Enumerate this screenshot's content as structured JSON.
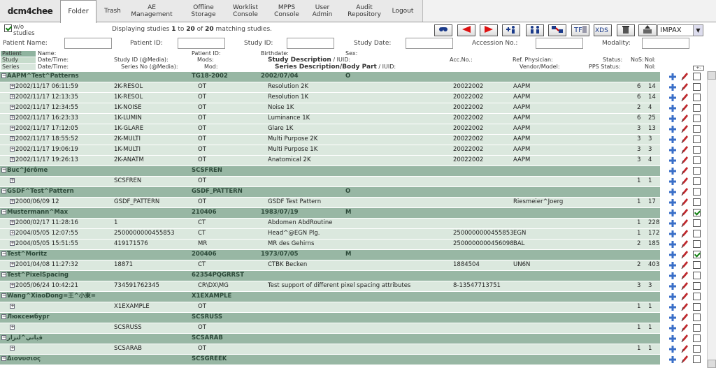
{
  "app": {
    "logo": "dcm4chee"
  },
  "tabs": [
    {
      "label": "Folder",
      "active": true
    },
    {
      "label": "Trash"
    },
    {
      "label": "AE\nManagement"
    },
    {
      "label": "Offline\nStorage"
    },
    {
      "label": "Worklist\nConsole"
    },
    {
      "label": "MPPS\nConsole"
    },
    {
      "label": "User\nAdmin"
    },
    {
      "label": "Audit\nRepository"
    },
    {
      "label": "Logout"
    }
  ],
  "toolbar": {
    "wo_label": "w/o studies",
    "wo_checked": true,
    "display_prefix": "Displaying studies ",
    "from": "1",
    "to_word": " to ",
    "to": "20",
    "of_word": " of ",
    "total": "20",
    "suffix": " matching studies.",
    "buttons": [
      "search-icon",
      "prev-icon",
      "next-icon",
      "add-patient-icon",
      "merge-patients-icon",
      "move-studies-icon",
      "tf-export-icon",
      "xds-export-icon",
      "trash-icon",
      "send-icon"
    ],
    "aet_select": "IMPAX"
  },
  "filters": {
    "patient_name": {
      "label": "Patient Name:",
      "value": ""
    },
    "patient_id": {
      "label": "Patient ID:",
      "value": ""
    },
    "study_id": {
      "label": "Study ID:",
      "value": ""
    },
    "study_date": {
      "label": "Study Date:",
      "value": ""
    },
    "accession": {
      "label": "Accession No.:",
      "value": ""
    },
    "modality": {
      "label": "Modality:",
      "value": ""
    }
  },
  "header": {
    "l_patient": "Patient",
    "l_study": "Study",
    "l_series": "Series",
    "name": "Name:",
    "patient_id": "Patient ID:",
    "birthdate": "Birthdate:",
    "sex": "Sex:",
    "study_datetime": "Date/Time:",
    "study_id": "Study ID (@Media):",
    "mods": "Mods:",
    "study_desc": "Study Description",
    "iuid1": " / IUID:",
    "acc": "Acc.No.:",
    "ref_phys": "Ref. Physician:",
    "status": "Status:",
    "nos": "NoS:",
    "noi": "NoI:",
    "series_datetime": "Date/Time:",
    "series_no": "Series No (@Media):",
    "mod": "Mod:",
    "series_desc": "Series Description/Body Part",
    "iuid2": " / IUID:",
    "vendor": "Vendor/Model:",
    "pps_status": "PPS Status:",
    "noi2": "NoI:"
  },
  "rows": [
    {
      "type": "pat",
      "name": "AAPM^Test^Patterns",
      "pid": "TG18-2002",
      "birth": "2002/07/04",
      "sex": "O"
    },
    {
      "type": "ser",
      "dt": "2002/11/17 06:11:59",
      "no": "2K-RESOL",
      "mod": "OT",
      "desc": "Resolution 2K",
      "acc": "20022002",
      "ref": "AAPM",
      "nos": "6",
      "noi": "14"
    },
    {
      "type": "ser",
      "dt": "2002/11/17 12:13:35",
      "no": "1K-RESOL",
      "mod": "OT",
      "desc": "Resolution 1K",
      "acc": "20022002",
      "ref": "AAPM",
      "nos": "6",
      "noi": "14"
    },
    {
      "type": "ser",
      "dt": "2002/11/17 12:34:55",
      "no": "1K-NOISE",
      "mod": "OT",
      "desc": "Noise 1K",
      "acc": "20022002",
      "ref": "AAPM",
      "nos": "2",
      "noi": "4"
    },
    {
      "type": "ser",
      "dt": "2002/11/17 16:23:33",
      "no": "1K-LUMIN",
      "mod": "OT",
      "desc": "Luminance 1K",
      "acc": "20022002",
      "ref": "AAPM",
      "nos": "6",
      "noi": "25"
    },
    {
      "type": "ser",
      "dt": "2002/11/17 17:12:05",
      "no": "1K-GLARE",
      "mod": "OT",
      "desc": "Glare 1K",
      "acc": "20022002",
      "ref": "AAPM",
      "nos": "3",
      "noi": "13"
    },
    {
      "type": "ser",
      "dt": "2002/11/17 18:55:52",
      "no": "2K-MULTI",
      "mod": "OT",
      "desc": "Multi Purpose 2K",
      "acc": "20022002",
      "ref": "AAPM",
      "nos": "3",
      "noi": "3"
    },
    {
      "type": "ser",
      "dt": "2002/11/17 19:06:19",
      "no": "1K-MULTI",
      "mod": "OT",
      "desc": "Multi Purpose 1K",
      "acc": "20022002",
      "ref": "AAPM",
      "nos": "3",
      "noi": "3"
    },
    {
      "type": "ser",
      "dt": "2002/11/17 19:26:13",
      "no": "2K-ANATM",
      "mod": "OT",
      "desc": "Anatomical 2K",
      "acc": "20022002",
      "ref": "AAPM",
      "nos": "3",
      "noi": "4"
    },
    {
      "type": "pat",
      "name": "Buc^Jérôme",
      "pid": "SCSFREN",
      "birth": "",
      "sex": ""
    },
    {
      "type": "ser",
      "dt": "",
      "no": "SCSFREN",
      "mod": "OT",
      "desc": "",
      "acc": "",
      "ref": "",
      "nos": "1",
      "noi": "1"
    },
    {
      "type": "pat",
      "name": "GSDF^Test^Pattern",
      "pid": "GSDF_PATTERN",
      "birth": "",
      "sex": "O"
    },
    {
      "type": "ser",
      "dt": "2000/06/09 12",
      "no": "GSDF_PATTERN",
      "mod": "OT",
      "desc": "GSDF Test Pattern",
      "acc": "",
      "ref": "Riesmeier^Joerg",
      "nos": "1",
      "noi": "17"
    },
    {
      "type": "pat",
      "name": "Mustermann^Max",
      "pid": "210406",
      "birth": "1983/07/19",
      "sex": "M",
      "checked": true
    },
    {
      "type": "ser",
      "dt": "2000/02/17 11:28:16",
      "no": "1",
      "mod": "CT",
      "desc": "Abdomen AbdRoutine",
      "acc": "",
      "ref": "",
      "nos": "1",
      "noi": "228"
    },
    {
      "type": "ser",
      "dt": "2004/05/05 12:07:55",
      "no": "2500000000455853",
      "mod": "CT",
      "desc": "Head^@EGN Plg.",
      "acc": "2500000000455853",
      "ref": "EGN",
      "nos": "1",
      "noi": "172"
    },
    {
      "type": "ser",
      "dt": "2004/05/05 15:51:55",
      "no": "419171576",
      "mod": "MR",
      "desc": "MR des Gehirns",
      "acc": "2500000000456098",
      "ref": "BAL",
      "nos": "2",
      "noi": "185"
    },
    {
      "type": "pat",
      "name": "Test^Moritz",
      "pid": "200406",
      "birth": "1973/07/05",
      "sex": "M",
      "checked": true
    },
    {
      "type": "ser",
      "dt": "2001/04/08 11:27:32",
      "no": "18871",
      "mod": "CT",
      "desc": "CTBK Becken",
      "acc": "1884504",
      "ref": "UN6N",
      "nos": "2",
      "noi": "403"
    },
    {
      "type": "pat",
      "name": "Test^PixelSpacing",
      "pid": "62354PQGRRST",
      "birth": "",
      "sex": ""
    },
    {
      "type": "ser",
      "dt": "2005/06/24 10:42:21",
      "no": "734591762345",
      "mod": "CR\\DX\\MG",
      "desc": "Test support of different pixel spacing attributes",
      "acc": "8-13547713751",
      "ref": "",
      "nos": "3",
      "noi": "3"
    },
    {
      "type": "pat",
      "name": "Wang^XiaoDong=王^小東=",
      "pid": "X1EXAMPLE",
      "birth": "",
      "sex": ""
    },
    {
      "type": "ser",
      "dt": "",
      "no": "X1EXAMPLE",
      "mod": "OT",
      "desc": "",
      "acc": "",
      "ref": "",
      "nos": "1",
      "noi": "1"
    },
    {
      "type": "pat",
      "name": "Люксембург",
      "pid": "SCSRUSS",
      "birth": "",
      "sex": ""
    },
    {
      "type": "ser",
      "dt": "",
      "no": "SCSRUSS",
      "mod": "OT",
      "desc": "",
      "acc": "",
      "ref": "",
      "nos": "1",
      "noi": "1"
    },
    {
      "type": "pat",
      "name": "قباني^لنزار",
      "pid": "SCSARAB",
      "birth": "",
      "sex": ""
    },
    {
      "type": "ser",
      "dt": "",
      "no": "SCSARAB",
      "mod": "OT",
      "desc": "",
      "acc": "",
      "ref": "",
      "nos": "1",
      "noi": "1"
    },
    {
      "type": "pat",
      "name": "Διονυσιος",
      "pid": "SCSGREEK",
      "birth": "",
      "sex": ""
    }
  ]
}
